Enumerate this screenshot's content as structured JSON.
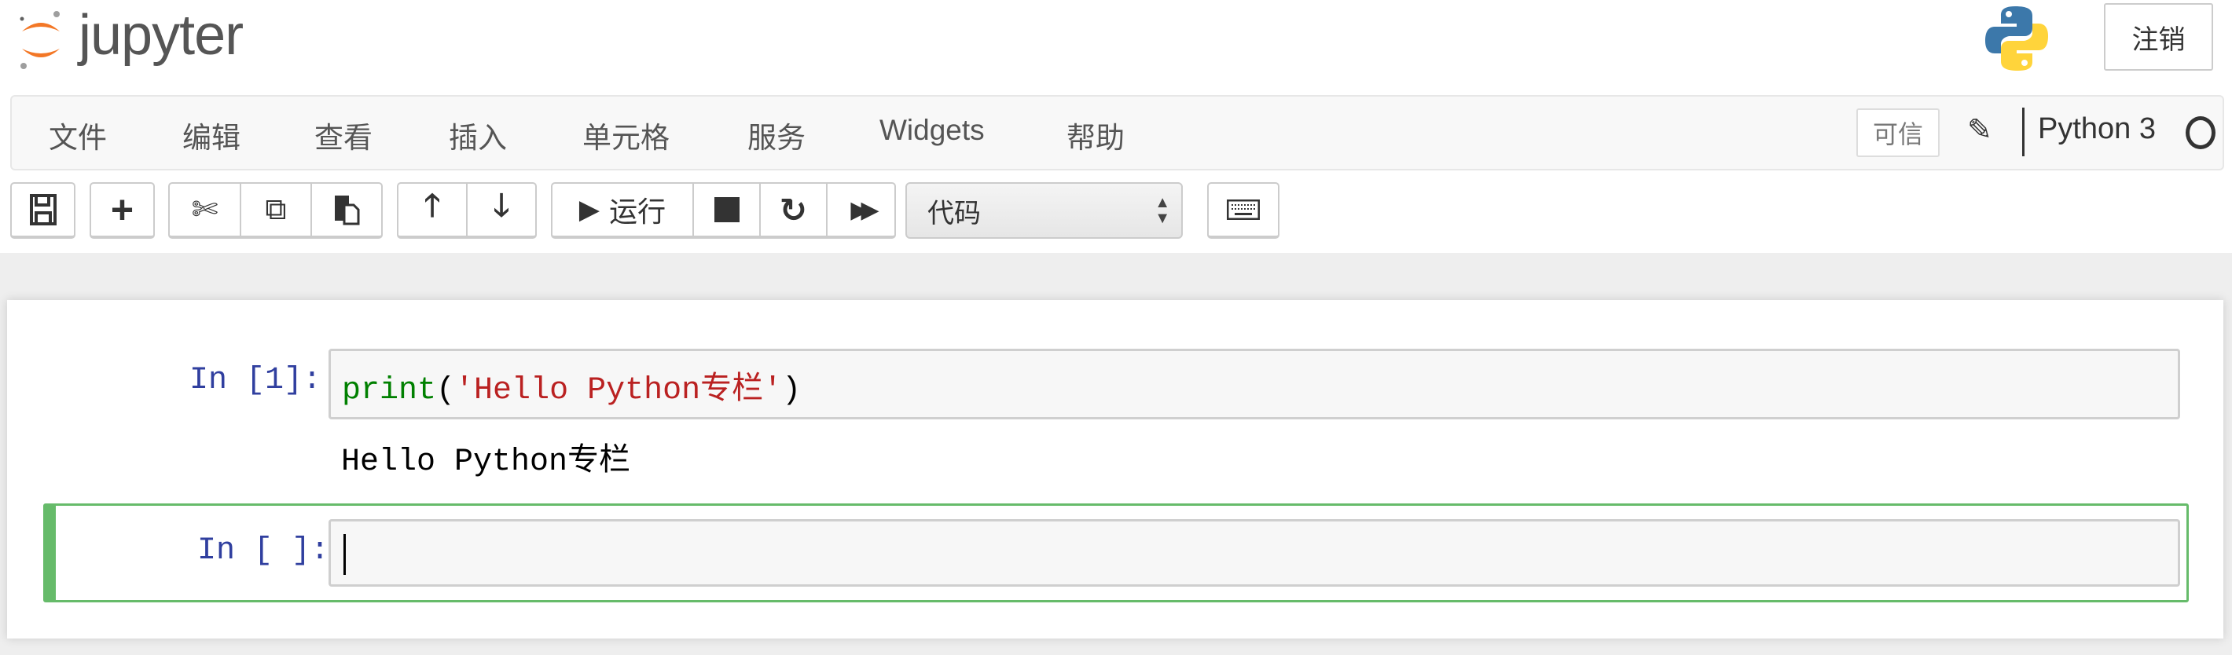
{
  "header": {
    "logo_text": "jupyter",
    "kernel_logo": "python-logo",
    "logout_label": "注销"
  },
  "menubar": {
    "items": [
      "文件",
      "编辑",
      "查看",
      "插入",
      "单元格",
      "服务",
      "Widgets",
      "帮助"
    ],
    "trusted_label": "可信",
    "kernel_name": "Python 3",
    "kernel_status": "idle"
  },
  "toolbar": {
    "icons": [
      "save-icon",
      "plus-icon",
      "cut-icon",
      "copy-icon",
      "paste-icon",
      "arrow-up-icon",
      "arrow-down-icon",
      "play-icon",
      "stop-icon",
      "restart-icon",
      "fast-forward-icon",
      "keyboard-icon"
    ],
    "run_label": "运行",
    "cell_type": "代码"
  },
  "cells": [
    {
      "prompt": "In [1]:",
      "code": {
        "func": "print",
        "open": "(",
        "string": "'Hello Python专栏'",
        "close": ")"
      },
      "output": "Hello Python专栏"
    },
    {
      "prompt": "In [ ]:",
      "code": "",
      "selected": true
    }
  ],
  "colors": {
    "accent_selected": "#66BB6A",
    "prompt": "#303F9F",
    "keyword": "#008000",
    "string": "#BA2121",
    "jupyter_orange": "#F37726"
  }
}
